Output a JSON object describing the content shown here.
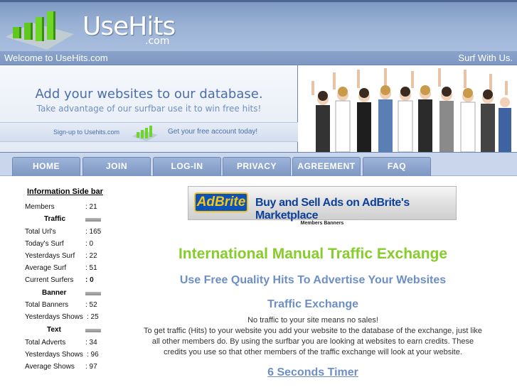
{
  "header": {
    "logo_text": "UseHits",
    "logo_sub": ".com",
    "welcome": "Welcome to UseHits.com",
    "tagline": "Surf With Us."
  },
  "banner": {
    "title": "Add your websites to our database.",
    "subtitle": "Take advantage of our surfbar use it to win free hits!",
    "signup_text": "Sign-up to Usehits.com",
    "free_account_text": "Get your free account today!"
  },
  "nav": {
    "items": [
      {
        "label": "HOME"
      },
      {
        "label": "JOIN"
      },
      {
        "label": "LOG-IN"
      },
      {
        "label": "PRIVACY"
      },
      {
        "label": "AGREEMENT"
      },
      {
        "label": "FAQ"
      }
    ]
  },
  "sidebar": {
    "title": "Information Side bar",
    "members": {
      "label": "Members",
      "value": ": 21"
    },
    "traffic": {
      "heading": "Traffic",
      "rows": [
        {
          "label": "Total Url's",
          "value": ": 165"
        },
        {
          "label": "Today's Surf",
          "value": ": 0"
        },
        {
          "label": "Yesterdays Surf",
          "value": ": 22"
        },
        {
          "label": "Average Surf",
          "value": ": 51"
        },
        {
          "label": "Current Surfers",
          "value": ": 0"
        }
      ]
    },
    "banner": {
      "heading": "Banner",
      "rows": [
        {
          "label": "Total Banners",
          "value": ": 52"
        },
        {
          "label": "Yesterdays Shows",
          "value": ": 25"
        }
      ]
    },
    "text": {
      "heading": "Text",
      "rows": [
        {
          "label": "Total Adverts",
          "value": ": 34"
        },
        {
          "label": "Yesterdays Shows",
          "value": ": 96"
        },
        {
          "label": "Average Shows",
          "value": ": 97"
        }
      ]
    }
  },
  "main": {
    "ad_logo": "AdBrite",
    "ad_text": "Buy and Sell Ads on AdBrite's Marketplace",
    "members_banners": "Members Banners",
    "headline": "International Manual Traffic Exchange",
    "subheadline": "Use Free Quality Hits To Advertise Your Websites",
    "section_title": "Traffic Exchange",
    "para_lines": [
      "No traffic to your site means no sales!",
      "To get traffic (Hits) to your website you add your website to the database of the exchange, just like",
      "all other members do. By using the surfbar you are looking at websites to earn credits. These",
      "credits you use so that other members of the traffic exchange will look at your website."
    ],
    "timer_link": "6 Seconds Timer"
  }
}
